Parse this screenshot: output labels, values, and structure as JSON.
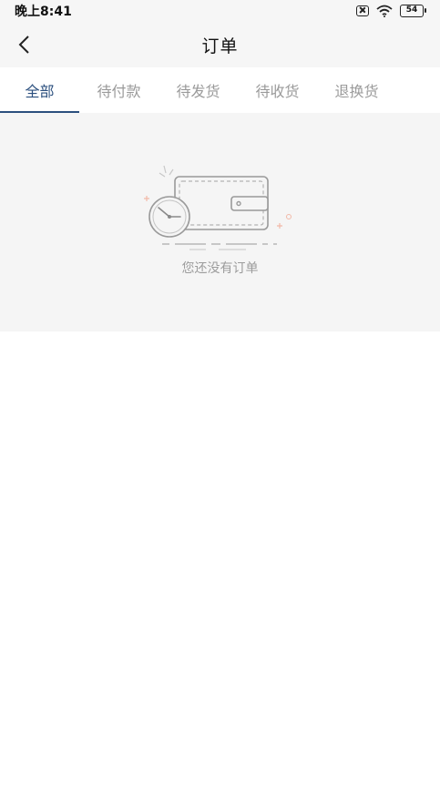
{
  "status_bar": {
    "time": "晚上8:41",
    "battery": "54",
    "icons": [
      "sim-x-icon",
      "wifi-icon",
      "battery-icon"
    ]
  },
  "nav": {
    "title": "订单",
    "back_icon": "chevron-left-icon"
  },
  "tabs": [
    {
      "label": "全部",
      "active": true
    },
    {
      "label": "待付款",
      "active": false
    },
    {
      "label": "待发货",
      "active": false
    },
    {
      "label": "待收货",
      "active": false
    },
    {
      "label": "退换货",
      "active": false
    }
  ],
  "empty_state": {
    "icon": "empty-wallet-clock-icon",
    "message": "您还没有订单"
  },
  "colors": {
    "accent": "#2b4f7e",
    "tab_inactive": "#9a9a9a",
    "content_bg": "#f5f5f5",
    "bar_bg": "#f6f6f6"
  }
}
